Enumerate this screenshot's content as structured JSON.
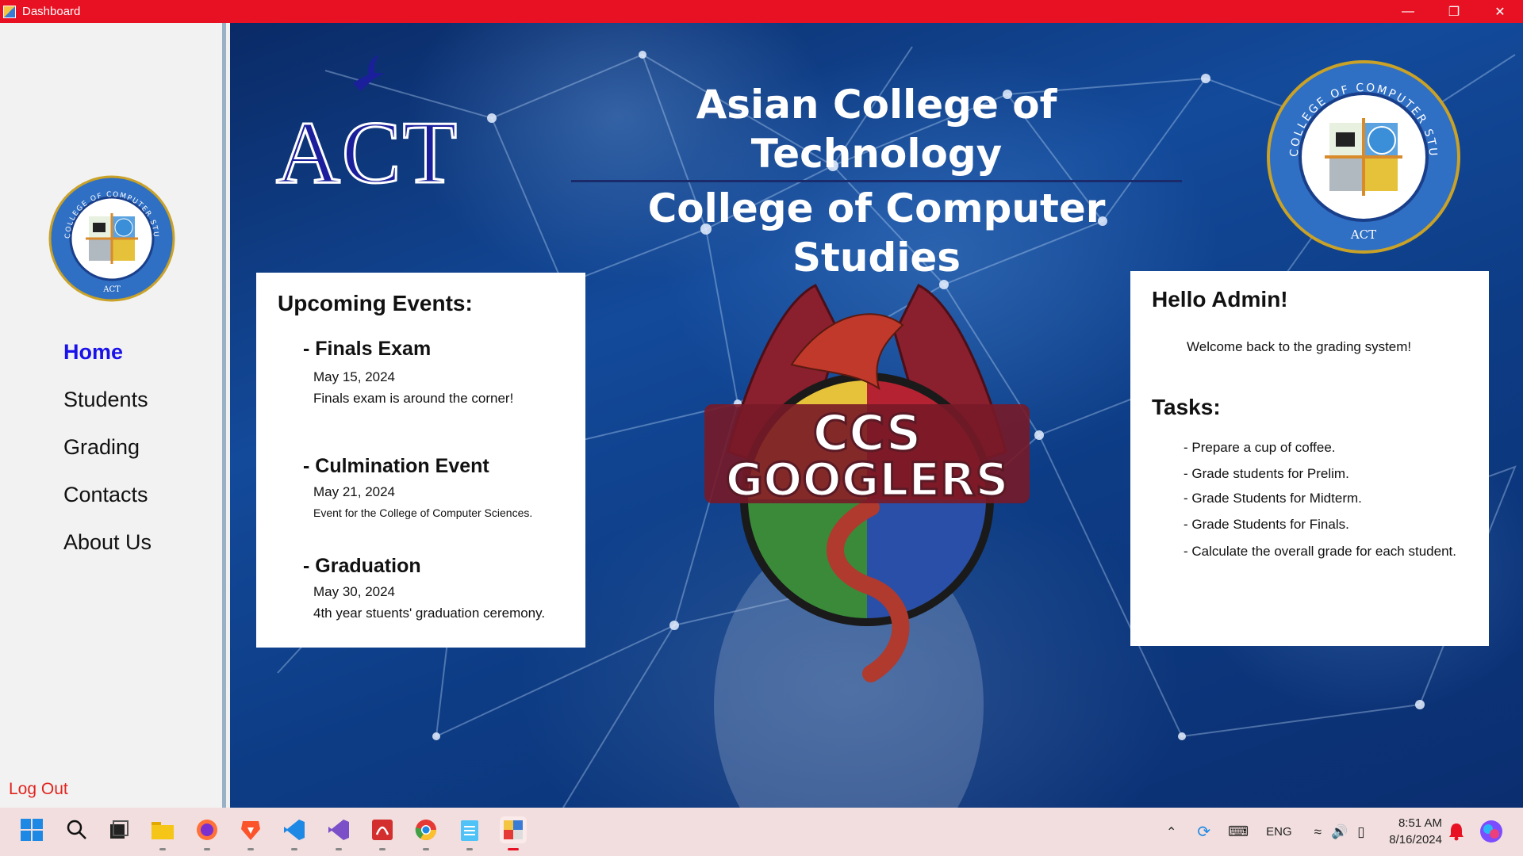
{
  "window": {
    "title": "Dashboard",
    "controls": [
      "minimize-icon",
      "restore-icon",
      "close-icon"
    ]
  },
  "sidebar": {
    "items": [
      {
        "label": "Home",
        "active": true
      },
      {
        "label": "Students",
        "active": false
      },
      {
        "label": "Grading",
        "active": false
      },
      {
        "label": "Contacts",
        "active": false
      },
      {
        "label": "About Us",
        "active": false
      }
    ],
    "logout": "Log Out",
    "seal": {
      "top_text": "COLLEGE OF COMPUTER STUDIES",
      "bottom_text": "ACT"
    }
  },
  "header": {
    "logo_text": "ACT",
    "line1": "Asian College of Technology",
    "line2": "College of Computer Studies"
  },
  "events": {
    "heading": "Upcoming Events:",
    "items": [
      {
        "title": "- Finals Exam",
        "date": "May 15, 2024",
        "desc": "Finals exam is around the corner!"
      },
      {
        "title": "- Culmination Event",
        "date": "May 21, 2024",
        "desc": "Event for the College of Computer Sciences."
      },
      {
        "title": "- Graduation",
        "date": "May 30, 2024",
        "desc": "4th year stuents' graduation ceremony."
      }
    ]
  },
  "welcome": {
    "hello": "Hello Admin!",
    "message": "Welcome back to the grading system!",
    "tasks_heading": "Tasks:",
    "tasks": [
      "- Prepare a cup of coffee.",
      "- Grade students for Prelim.",
      "- Grade Students for Midterm.",
      "- Grade Students for Finals.",
      "- Calculate the overall grade for each student."
    ]
  },
  "emblem": {
    "line1": "CCS",
    "line2": "GOOGLERS"
  },
  "taskbar": {
    "apps": [
      "start-icon",
      "search-icon",
      "task-view-icon",
      "file-explorer-icon",
      "firefox-icon",
      "brave-icon",
      "vscode-icon",
      "visual-studio-icon",
      "pdf-app-icon",
      "chrome-icon",
      "notepad-icon",
      "dashboard-app-icon"
    ],
    "language": "ENG",
    "time": "8:51 AM",
    "date": "8/16/2024"
  },
  "colors": {
    "titlebar": "#e81123",
    "active_nav": "#1a12e8",
    "logout": "#e0241f",
    "header_text": "#ffffff",
    "act_blue": "#1b1f9c"
  }
}
